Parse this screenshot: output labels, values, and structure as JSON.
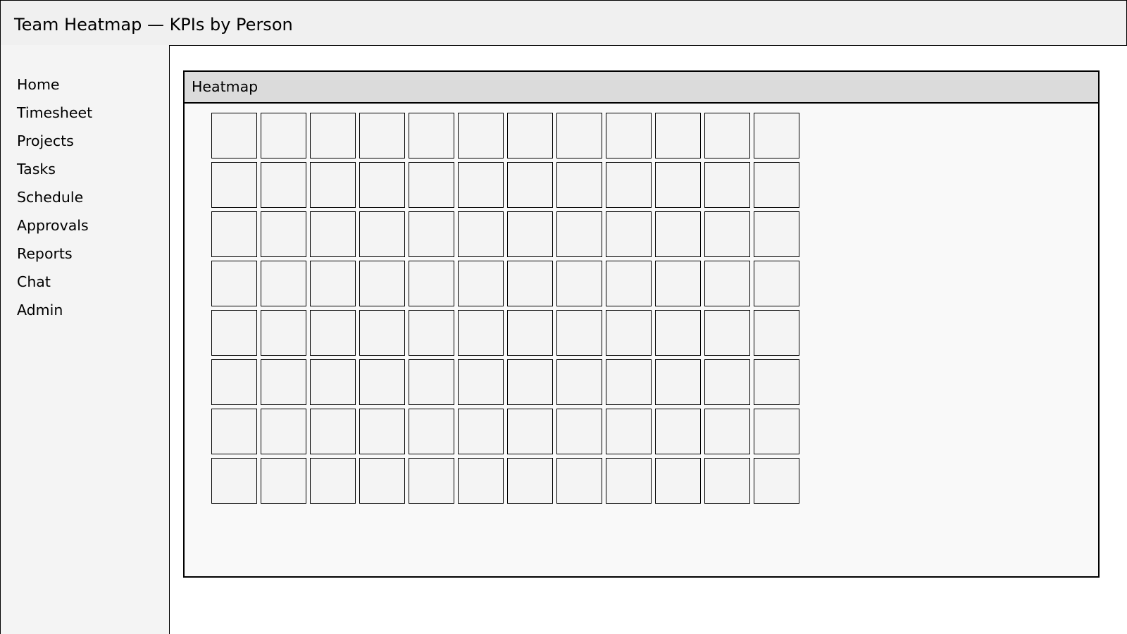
{
  "app": {
    "title": "Team Heatmap — KPIs by Person"
  },
  "sidebar": {
    "items": [
      {
        "label": "Home"
      },
      {
        "label": "Timesheet"
      },
      {
        "label": "Projects"
      },
      {
        "label": "Tasks"
      },
      {
        "label": "Schedule"
      },
      {
        "label": "Approvals"
      },
      {
        "label": "Reports"
      },
      {
        "label": "Chat"
      },
      {
        "label": "Admin"
      }
    ]
  },
  "heatmap": {
    "title": "Heatmap",
    "rows": 8,
    "columns": 12,
    "cell_color": "#f4f4f4"
  },
  "colors": {
    "titlebar_bg": "#f0f0f0",
    "sidebar_bg": "#f4f4f4",
    "panel_header_bg": "#dbdbdb",
    "panel_bg": "#f9f9f9",
    "border": "#000000"
  }
}
